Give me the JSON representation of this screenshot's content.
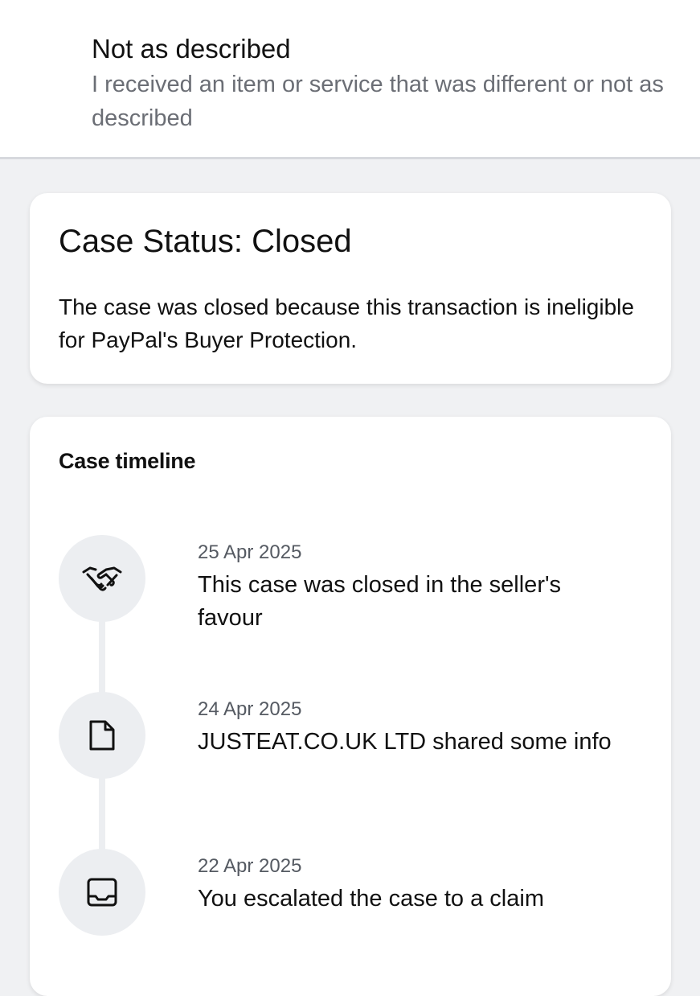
{
  "reason": {
    "title": "Not as described",
    "description": "I received an item or service that was different or not as described"
  },
  "status": {
    "title": "Case Status: Closed",
    "description": "The case was closed because this transaction is ineligible for PayPal's Buyer Protection."
  },
  "timeline": {
    "title": "Case timeline",
    "events": [
      {
        "date": "25 Apr 2025",
        "text": "This case was closed in the seller's favour",
        "icon": "handshake-icon"
      },
      {
        "date": "24 Apr 2025",
        "text": "JUSTEAT.CO.UK LTD shared some info",
        "icon": "document-icon"
      },
      {
        "date": "22 Apr 2025",
        "text": "You escalated the case to a claim",
        "icon": "inbox-tray-icon"
      }
    ]
  }
}
